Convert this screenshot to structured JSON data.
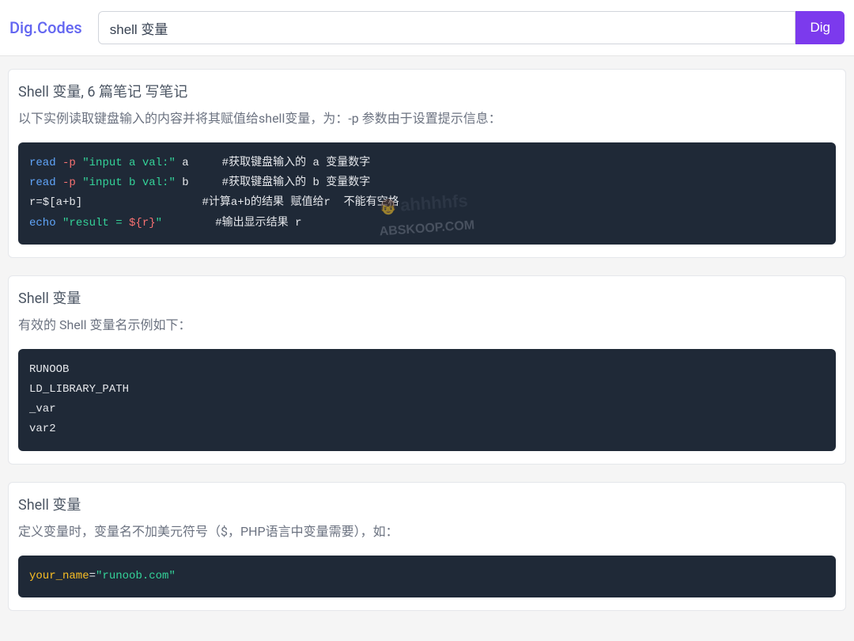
{
  "header": {
    "logo": "Dig.Codes",
    "search_value": "shell 变量",
    "search_button": "Dig"
  },
  "watermark": {
    "line1": "ahhhhfs",
    "line2": "ABSKOOP.COM"
  },
  "cards": [
    {
      "title": "Shell 变量, 6 篇笔记 写笔记",
      "desc": "以下实例读取键盘输入的内容并将其赋值给shell变量，为：-p 参数由于设置提示信息：",
      "code": [
        {
          "segments": [
            {
              "cls": "tok-kw",
              "text": "read"
            },
            {
              "cls": "tok-plain",
              "text": " "
            },
            {
              "cls": "tok-flag",
              "text": "-p"
            },
            {
              "cls": "tok-plain",
              "text": " "
            },
            {
              "cls": "tok-str",
              "text": "\"input a val:\""
            },
            {
              "cls": "tok-plain",
              "text": " a     "
            },
            {
              "cls": "tok-comment",
              "text": "#获取键盘输入的 a 变量数字"
            }
          ]
        },
        {
          "segments": [
            {
              "cls": "tok-kw",
              "text": "read"
            },
            {
              "cls": "tok-plain",
              "text": " "
            },
            {
              "cls": "tok-flag",
              "text": "-p"
            },
            {
              "cls": "tok-plain",
              "text": " "
            },
            {
              "cls": "tok-str",
              "text": "\"input b val:\""
            },
            {
              "cls": "tok-plain",
              "text": " b     "
            },
            {
              "cls": "tok-comment",
              "text": "#获取键盘输入的 b 变量数字"
            }
          ]
        },
        {
          "segments": [
            {
              "cls": "tok-plain",
              "text": "r=$[a+b]                  "
            },
            {
              "cls": "tok-comment",
              "text": "#计算a+b的结果 赋值给r  不能有空格"
            }
          ]
        },
        {
          "segments": [
            {
              "cls": "tok-kw",
              "text": "echo"
            },
            {
              "cls": "tok-plain",
              "text": " "
            },
            {
              "cls": "tok-str",
              "text": "\"result = "
            },
            {
              "cls": "tok-interp",
              "text": "${r}"
            },
            {
              "cls": "tok-str",
              "text": "\""
            },
            {
              "cls": "tok-plain",
              "text": "        "
            },
            {
              "cls": "tok-comment",
              "text": "#输出显示结果 r"
            }
          ]
        }
      ],
      "has_watermark": true
    },
    {
      "title": "Shell 变量",
      "desc": "有效的 Shell 变量名示例如下：",
      "code": [
        {
          "segments": [
            {
              "cls": "tok-plain",
              "text": "RUNOOB"
            }
          ]
        },
        {
          "segments": [
            {
              "cls": "tok-plain",
              "text": "LD_LIBRARY_PATH"
            }
          ]
        },
        {
          "segments": [
            {
              "cls": "tok-plain",
              "text": "_var"
            }
          ]
        },
        {
          "segments": [
            {
              "cls": "tok-plain",
              "text": "var2"
            }
          ]
        }
      ],
      "has_watermark": false
    },
    {
      "title": "Shell 变量",
      "desc": "定义变量时，变量名不加美元符号（$，PHP语言中变量需要），如：",
      "code": [
        {
          "segments": [
            {
              "cls": "tok-var",
              "text": "your_name"
            },
            {
              "cls": "tok-plain",
              "text": "="
            },
            {
              "cls": "tok-str",
              "text": "\"runoob.com\""
            }
          ]
        }
      ],
      "has_watermark": false
    }
  ]
}
